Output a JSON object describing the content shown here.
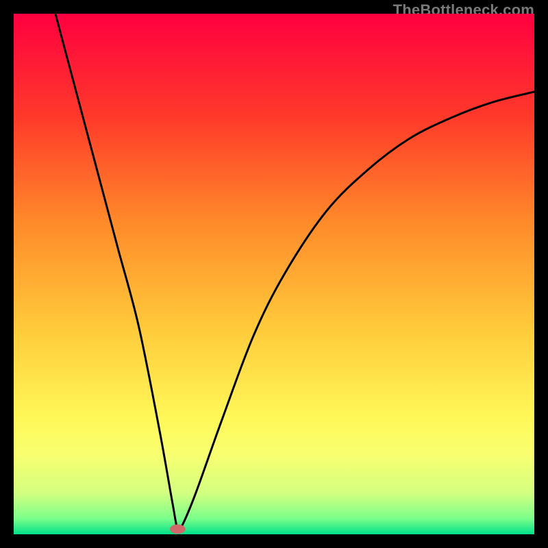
{
  "watermark": "TheBottleneck.com",
  "chart_data": {
    "type": "line",
    "title": "",
    "xlabel": "",
    "ylabel": "",
    "xlim": [
      0,
      100
    ],
    "ylim": [
      0,
      100
    ],
    "grid": false,
    "legend": false,
    "gradient_stops": [
      {
        "pos": 0,
        "color": "#ff0040"
      },
      {
        "pos": 20,
        "color": "#ff3a2a"
      },
      {
        "pos": 40,
        "color": "#ff8a2a"
      },
      {
        "pos": 60,
        "color": "#ffc93a"
      },
      {
        "pos": 78,
        "color": "#fff95a"
      },
      {
        "pos": 85,
        "color": "#f7ff70"
      },
      {
        "pos": 92,
        "color": "#d4ff80"
      },
      {
        "pos": 97,
        "color": "#7aff8a"
      },
      {
        "pos": 100,
        "color": "#00e08a"
      }
    ],
    "series": [
      {
        "name": "curve",
        "x": [
          8,
          12,
          16,
          20,
          24,
          28,
          30.5,
          31.5,
          32.5,
          35,
          40,
          46,
          52,
          60,
          68,
          76,
          84,
          92,
          100
        ],
        "y": [
          100,
          85,
          70,
          55,
          40,
          20,
          6,
          1,
          2,
          8,
          22,
          38,
          50,
          62,
          70,
          76,
          80,
          83,
          85
        ]
      }
    ],
    "marker": {
      "x": 31.5,
      "y": 1,
      "color": "#d06a6a",
      "rx": 1.5,
      "ry": 0.9
    }
  }
}
